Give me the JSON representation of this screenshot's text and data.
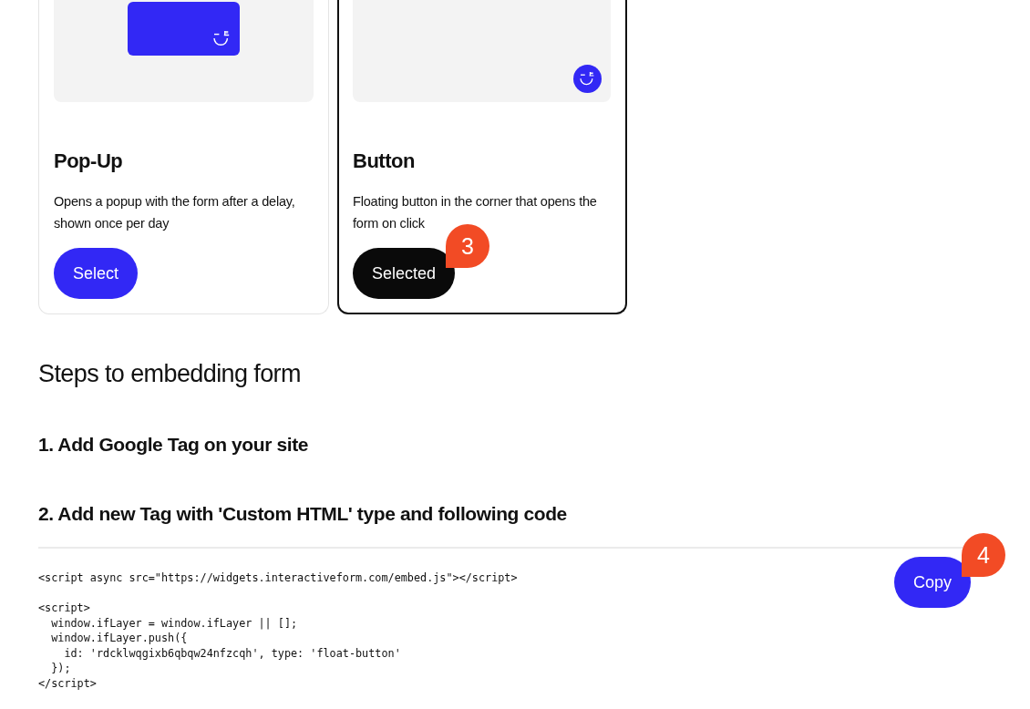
{
  "cards": [
    {
      "kind": "popup",
      "title": "Pop-Up",
      "description": "Opens a popup with the form after a delay, shown once per day",
      "button": "Select",
      "selected": false
    },
    {
      "kind": "button",
      "title": "Button",
      "description": "Floating button in the corner that opens the form on click",
      "button": "Selected",
      "selected": true,
      "badge": "3"
    }
  ],
  "heading": "Steps to embedding form",
  "steps": [
    "1. Add Google Tag on your site",
    "2. Add new Tag with 'Custom HTML' type and following code"
  ],
  "code": {
    "blocks": [
      [
        "<script async src=\"https://widgets.interactiveform.com/embed.js\"></script>"
      ],
      [
        "<script>",
        "  window.ifLayer = window.ifLayer || [];",
        "  window.ifLayer.push({",
        "    id: 'rdcklwqgixb6qbqw24nfzcqh', type: 'float-button'",
        "  });",
        "</script>"
      ]
    ],
    "button": "Copy",
    "badge": "4"
  }
}
